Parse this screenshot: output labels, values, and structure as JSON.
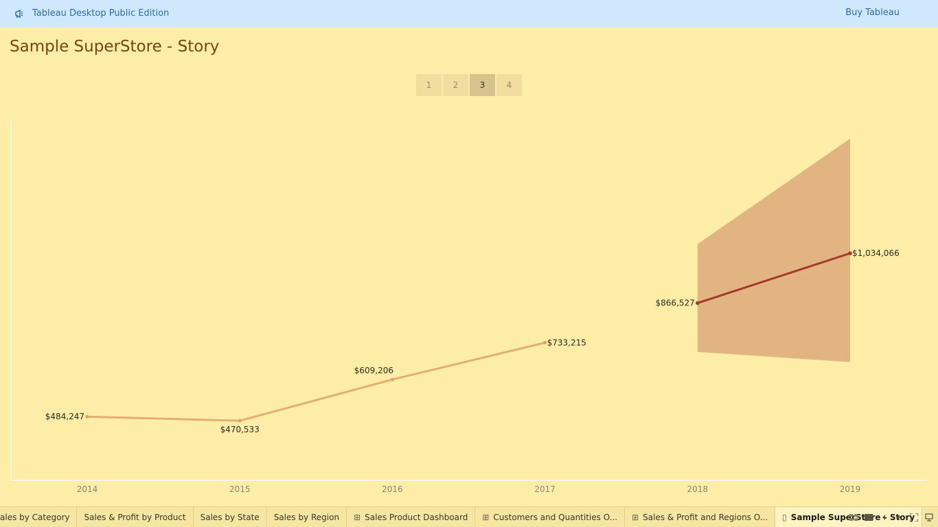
{
  "banner": {
    "app_title": "Tableau Desktop Public Edition",
    "buy_label": "Buy Tableau",
    "icon": "megaphone-icon"
  },
  "story": {
    "title": "Sample SuperStore - Story",
    "points": [
      "1",
      "2",
      "3",
      "4"
    ],
    "active_point": "3"
  },
  "chart_data": {
    "type": "line",
    "x": [
      "2014",
      "2015",
      "2016",
      "2017",
      "2018",
      "2019"
    ],
    "series": [
      {
        "values": [
          484247,
          470533,
          609206,
          733215,
          null,
          null
        ],
        "color": "#e5ae70"
      },
      {
        "values": [
          null,
          null,
          null,
          null,
          866527,
          1034066
        ],
        "color": "#a33a2e"
      }
    ],
    "forecast_band": {
      "x": [
        "2018",
        "2019"
      ],
      "upper": [
        1065000,
        1420000
      ],
      "lower": [
        702000,
        668000
      ],
      "color": "#e1b482"
    },
    "data_labels": [
      "$484,247",
      "$470,533",
      "$609,206",
      "$733,215",
      "$866,527",
      "$1,034,066"
    ],
    "ylim": [
      270000,
      1480000
    ],
    "grid": false
  },
  "tabs": [
    {
      "label": "ales by Category",
      "icon": ""
    },
    {
      "label": "Sales & Profit by Product",
      "icon": ""
    },
    {
      "label": "Sales by State",
      "icon": ""
    },
    {
      "label": "Sales by Region",
      "icon": ""
    },
    {
      "label": "Sales Product Dashboard",
      "icon": "dashboard-icon"
    },
    {
      "label": "Customers and Quantities O...",
      "icon": "dashboard-icon"
    },
    {
      "label": "Sales & Profit and Regions O...",
      "icon": "dashboard-icon"
    },
    {
      "label": "Sample SuperStore - Story",
      "icon": "story-icon",
      "active": true
    }
  ],
  "controls": [
    "sheet-sorter-icon",
    "filmstrip-icon",
    "prev-icon",
    "next-icon",
    "fullscreen-icon",
    "presentation-icon"
  ],
  "colors": {
    "accent": "#2a6d9e",
    "background": "#feeda6",
    "title": "#7a4516"
  }
}
